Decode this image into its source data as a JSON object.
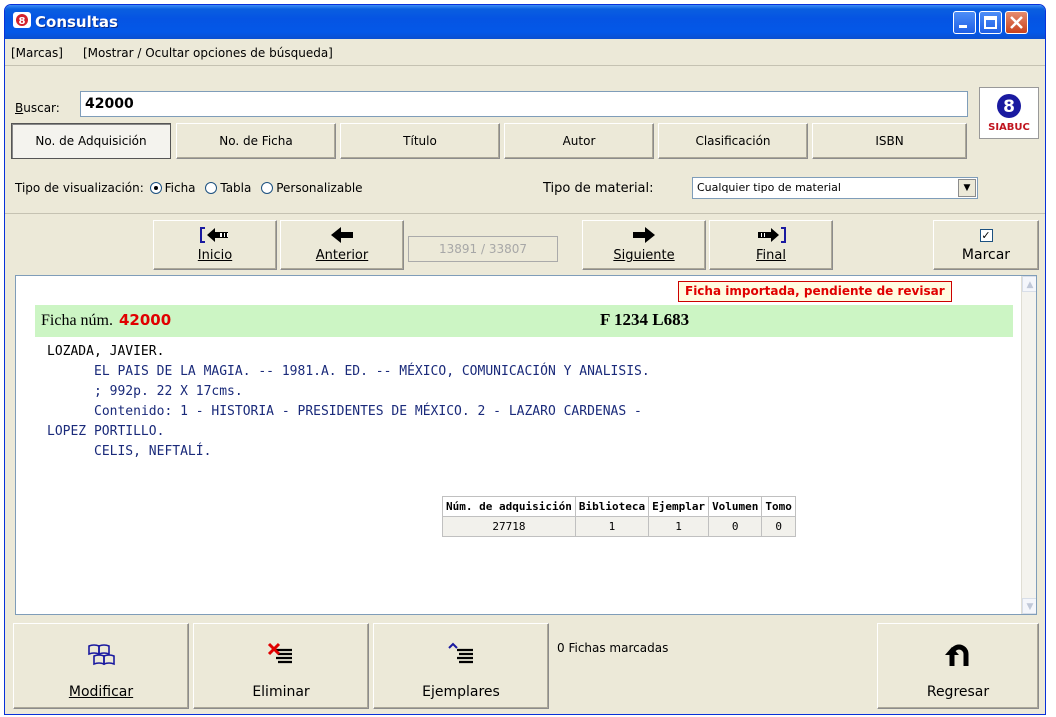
{
  "window": {
    "title": "Consultas"
  },
  "menu": {
    "marcas": "[Marcas]",
    "toggle_options": "[Mostrar / Ocultar opciones de búsqueda]"
  },
  "search": {
    "label": "Buscar:",
    "value": "42000",
    "fields": [
      "No. de Adquisición",
      "No. de Ficha",
      "Título",
      "Autor",
      "Clasificación",
      "ISBN"
    ],
    "active_field": "No. de Adquisición",
    "visualization_label": "Tipo de visualización:",
    "visualization_options": [
      "Ficha",
      "Tabla",
      "Personalizable"
    ],
    "visualization_selected": "Ficha",
    "material_label": "Tipo de material:",
    "material_value": "Cualquier tipo de material"
  },
  "logo": {
    "text": "SIABUC",
    "number": "8"
  },
  "nav": {
    "inicio": "Inicio",
    "anterior": "Anterior",
    "counter": "13891 / 33807",
    "siguiente": "Siguiente",
    "final": "Final",
    "marcar": "Marcar"
  },
  "record": {
    "warning": "Ficha importada, pendiente de revisar",
    "ficha_label": "Ficha núm.",
    "ficha_number": "42000",
    "classification": "F 1234 L683",
    "author": "LOZADA, JAVIER.",
    "line1": "EL PAIS DE LA MAGIA. -- 1981.A. ED. -- MÉXICO, COMUNICACIÓN Y ANALISIS.",
    "line2": "; 992p. 22 X 17cms.",
    "line3": "Contenido: 1 - HISTORIA - PRESIDENTES DE MÉXICO. 2 - LAZARO CARDENAS -",
    "line4": "LOPEZ PORTILLO.",
    "line5": "CELIS, NEFTALÍ.",
    "copies_table": {
      "headers": [
        "Núm. de adquisición",
        "Biblioteca",
        "Ejemplar",
        "Volumen",
        "Tomo"
      ],
      "rows": [
        [
          "27718",
          "1",
          "1",
          "0",
          "0"
        ]
      ]
    }
  },
  "bottom": {
    "modificar": "Modificar",
    "eliminar": "Eliminar",
    "ejemplares": "Ejemplares",
    "marked_count": "0 Fichas marcadas",
    "regresar": "Regresar"
  }
}
